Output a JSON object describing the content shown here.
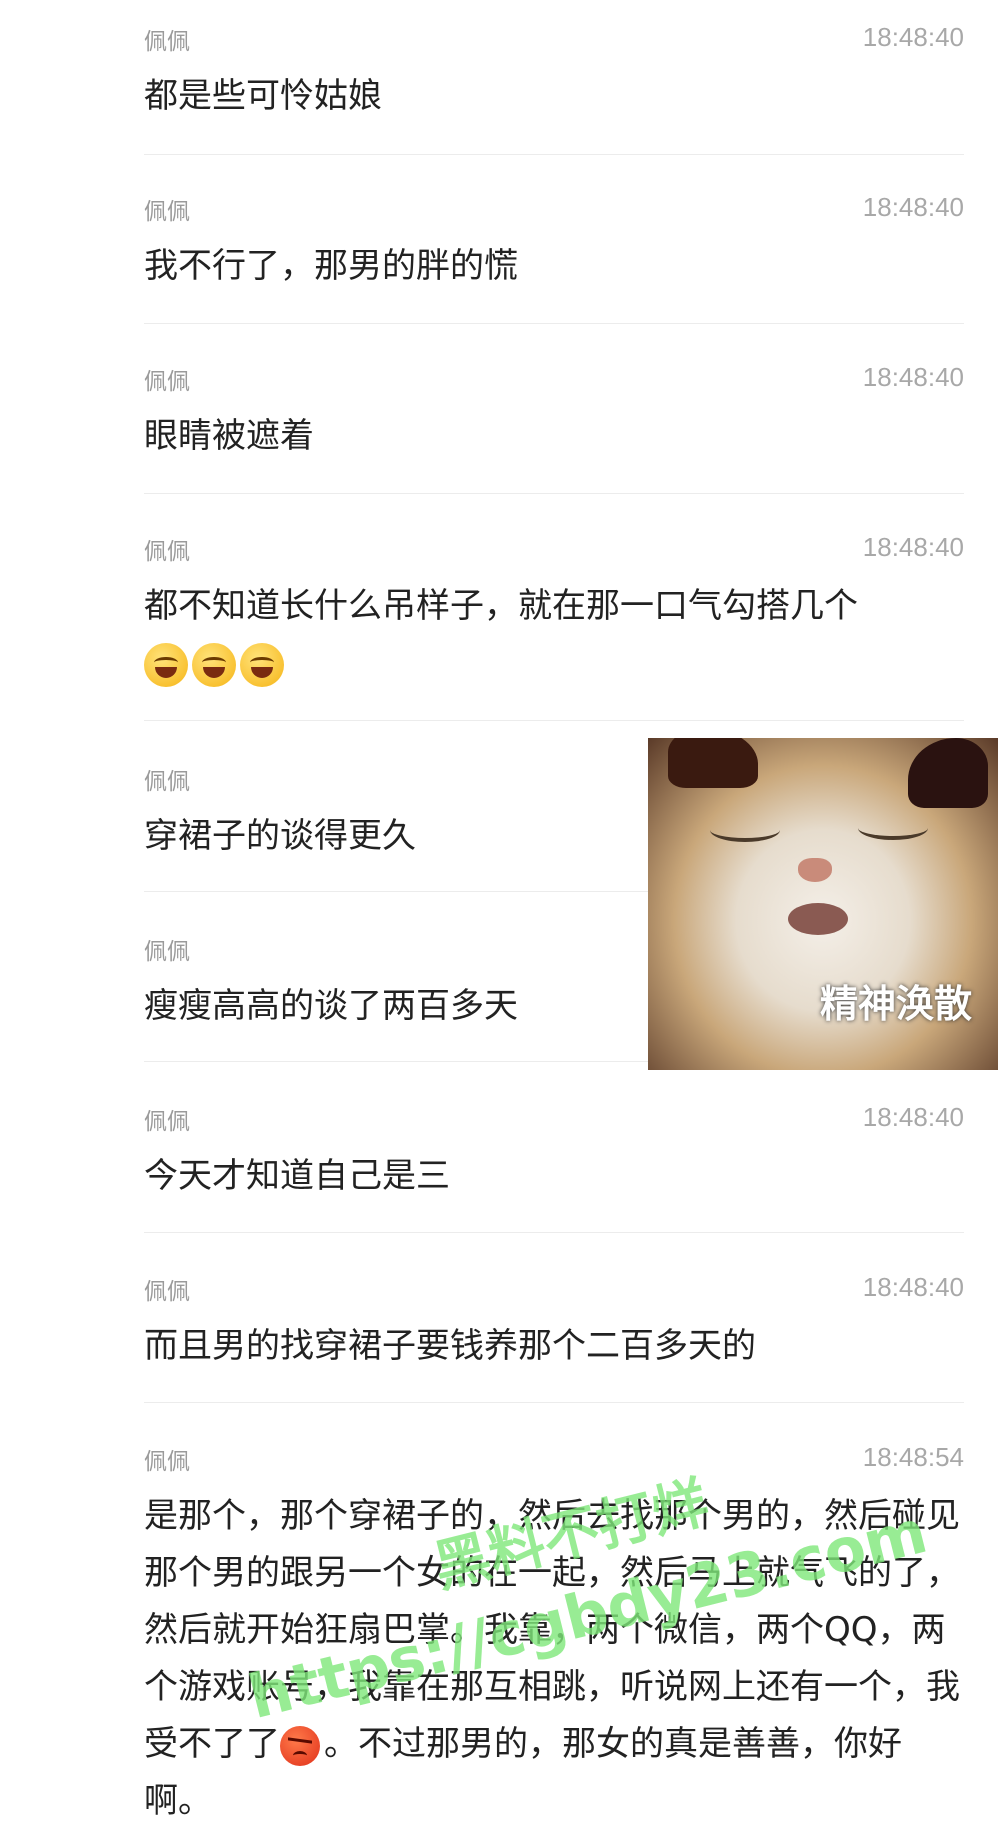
{
  "messages": [
    {
      "sender": "佩佩",
      "time": "18:48:40",
      "text": "都是些可怜姑娘"
    },
    {
      "sender": "佩佩",
      "time": "18:48:40",
      "text": "我不行了，那男的胖的慌"
    },
    {
      "sender": "佩佩",
      "time": "18:48:40",
      "text": "眼睛被遮着"
    },
    {
      "sender": "佩佩",
      "time": "18:48:40",
      "text": "都不知道长什么吊样子，就在那一口气勾搭几个"
    },
    {
      "sender": "佩佩",
      "time": "",
      "text": "穿裙子的谈得更久"
    },
    {
      "sender": "佩佩",
      "time": "",
      "text": "瘦瘦高高的谈了两百多天"
    },
    {
      "sender": "佩佩",
      "time": "18:48:40",
      "text": "今天才知道自己是三"
    },
    {
      "sender": "佩佩",
      "time": "18:48:40",
      "text": "而且男的找穿裙子要钱养那个二百多天的"
    },
    {
      "sender": "佩佩",
      "time": "18:48:54",
      "text_a": "是那个，那个穿裙子的，然后去找那个男的，然后碰见那个男的跟另一个女的在一起，然后马上就气飞的了，然后就开始狂扇巴掌。我靠，两个微信，两个QQ，两个游戏账号，我靠在那互相跳，听说网上还有一个，我受不了了",
      "text_b": "。不过那男的，那女的真是善善，你好啊。"
    }
  ],
  "emoji_names": [
    "laughing-tears-icon",
    "angry-face-icon"
  ],
  "sticker": {
    "caption": "精神涣散"
  },
  "watermark": {
    "line1": "黑料不打烊",
    "line2": "https://cgbdy23.com"
  }
}
